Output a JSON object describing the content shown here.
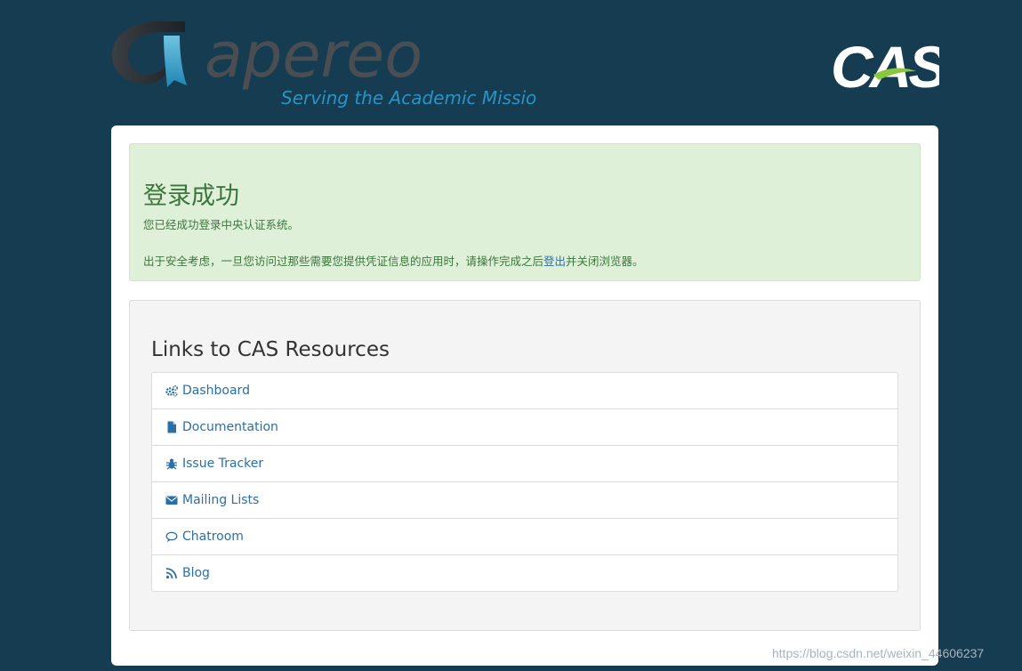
{
  "header": {
    "apereo_wordmark": "apereo",
    "apereo_tagline": "Serving the Academic Mission",
    "cas_wordmark": "CAS"
  },
  "alert": {
    "title": "登录成功",
    "message": "您已经成功登录中央认证系统。",
    "security_prefix": "出于安全考虑，一旦您访问过那些需要您提供凭证信息的应用时，请操作完成之后",
    "logout_link": "登出",
    "security_suffix": "并关闭浏览器。"
  },
  "resources": {
    "title": "Links to CAS Resources",
    "items": [
      {
        "label": "Dashboard",
        "icon": "gears-icon"
      },
      {
        "label": "Documentation",
        "icon": "file-icon"
      },
      {
        "label": "Issue Tracker",
        "icon": "bug-icon"
      },
      {
        "label": "Mailing Lists",
        "icon": "envelope-icon"
      },
      {
        "label": "Chatroom",
        "icon": "chat-bubble-icon"
      },
      {
        "label": "Blog",
        "icon": "rss-icon"
      }
    ]
  },
  "watermark": "https://blog.csdn.net/weixin_44606237",
  "colors": {
    "background": "#153c50",
    "link": "#2a6fa8",
    "success_bg": "#dff0d8",
    "success_text": "#3c763d"
  }
}
